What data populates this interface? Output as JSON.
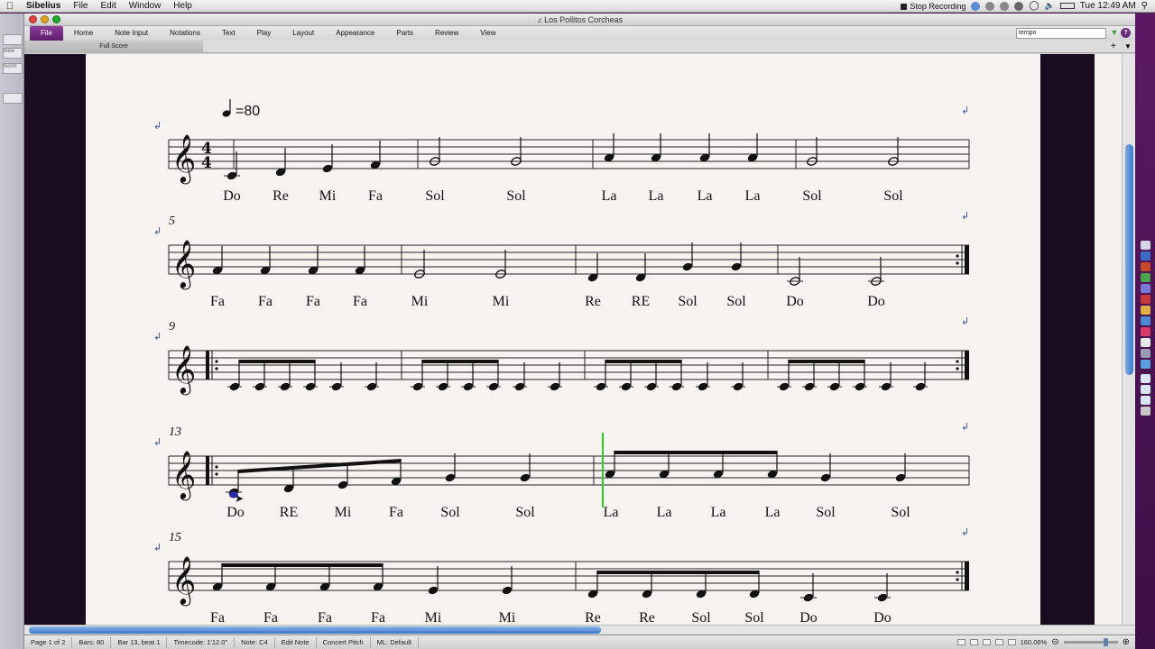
{
  "menubar": {
    "items": [
      "Sibelius",
      "File",
      "Edit",
      "Window",
      "Help"
    ],
    "stop_recording": "Stop Recording",
    "clock": "Tue 12:49 AM"
  },
  "window": {
    "title": "Los Pollitos Corcheas"
  },
  "ribbon": {
    "tabs": [
      "File",
      "Home",
      "Note Input",
      "Notations",
      "Text",
      "Play",
      "Layout",
      "Appearance",
      "Parts",
      "Review",
      "View"
    ],
    "search_value": "tempo",
    "help": "?"
  },
  "leftstrip": {
    "new": "New",
    "norm": "Norm"
  },
  "subbar": {
    "full_score": "Full Score"
  },
  "score": {
    "tempo": "=80",
    "time_signature": {
      "top": "4",
      "bottom": "4"
    },
    "systems": [
      {
        "bar_number": "",
        "syllables": [
          "Do",
          "Re",
          "Mi",
          "Fa",
          "Sol",
          "Sol",
          "La",
          "La",
          "La",
          "La",
          "Sol",
          "Sol"
        ]
      },
      {
        "bar_number": "5",
        "syllables": [
          "Fa",
          "Fa",
          "Fa",
          "Fa",
          "Mi",
          "Mi",
          "Re",
          "RE",
          "Sol",
          "Sol",
          "Do",
          "Do"
        ]
      },
      {
        "bar_number": "9",
        "syllables": []
      },
      {
        "bar_number": "13",
        "syllables": [
          "Do",
          "RE",
          "Mi",
          "Fa",
          "Sol",
          "Sol",
          "La",
          "La",
          "La",
          "La",
          "Sol",
          "Sol"
        ]
      },
      {
        "bar_number": "15",
        "syllables": [
          "Fa",
          "Fa",
          "Fa",
          "Fa",
          "Mi",
          "Mi",
          "Re",
          "Re",
          "Sol",
          "Sol",
          "Do",
          "Do"
        ]
      }
    ]
  },
  "status": {
    "page": "Page 1 of 2",
    "bars": "Bars: 80",
    "position": "Bar 13, beat 1",
    "timecode": "Timecode: 1'12.0\"",
    "note": "Note: C4",
    "mode": "Edit Note",
    "pitch": "Concert Pitch",
    "ml": "ML: Default",
    "zoom": "160.06%"
  }
}
